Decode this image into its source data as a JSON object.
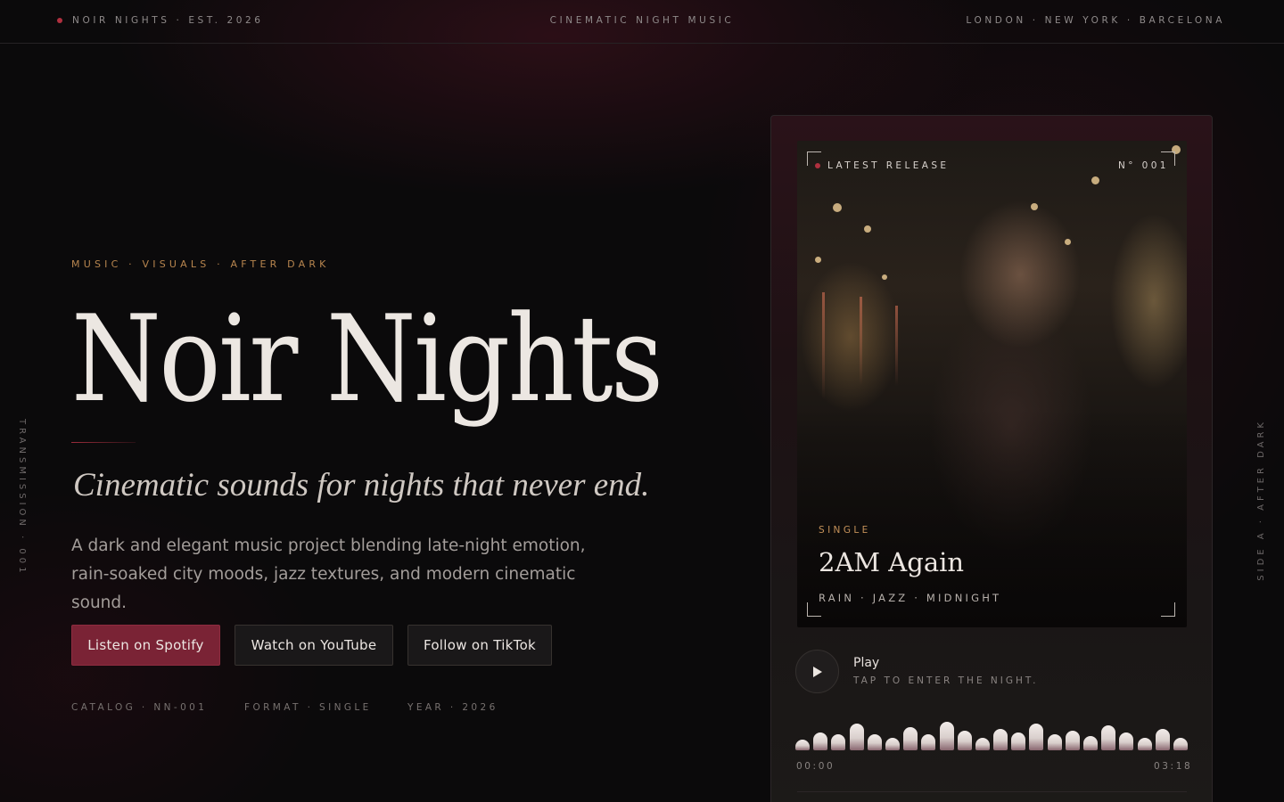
{
  "topbar": {
    "brand": "NOIR NIGHTS · EST. 2026",
    "center": "CINEMATIC NIGHT MUSIC",
    "cities": "LONDON · NEW YORK · BARCELONA"
  },
  "side": {
    "left": "TRANSMISSION · 001",
    "right": "SIDE A · AFTER DARK"
  },
  "hero": {
    "eyebrow": "MUSIC · VISUALS · AFTER DARK",
    "title": "Noir Nights",
    "tagline": "Cinematic sounds for nights that never end.",
    "description": "A dark and elegant music project blending late-night emotion, rain-soaked city moods, jazz textures, and modern cinematic sound."
  },
  "buttons": {
    "spotify": "Listen on Spotify",
    "youtube": "Watch on YouTube",
    "tiktok": "Follow on TikTok"
  },
  "meta": {
    "catalog": "CATALOG · NN-001",
    "format": "FORMAT · SINGLE",
    "year": "YEAR · 2026"
  },
  "release": {
    "label": "LATEST RELEASE",
    "number": "N° 001",
    "type": "SINGLE",
    "title": "2AM Again",
    "tags": "RAIN · JAZZ · MIDNIGHT"
  },
  "player": {
    "play_label": "Play",
    "hint": "TAP TO ENTER THE NIGHT.",
    "time_start": "00:00",
    "time_end": "03:18",
    "waveform_levels": [
      0.3,
      0.5,
      0.45,
      0.75,
      0.45,
      0.35,
      0.65,
      0.45,
      0.8,
      0.55,
      0.35,
      0.6,
      0.5,
      0.75,
      0.45,
      0.55,
      0.4,
      0.7,
      0.5,
      0.35,
      0.6,
      0.35
    ]
  },
  "colors": {
    "accent": "#7a2335",
    "gold": "#b8864f",
    "background": "#0b0a0b"
  },
  "icons": {
    "status_dot": "red-dot-icon",
    "play": "play-icon"
  }
}
